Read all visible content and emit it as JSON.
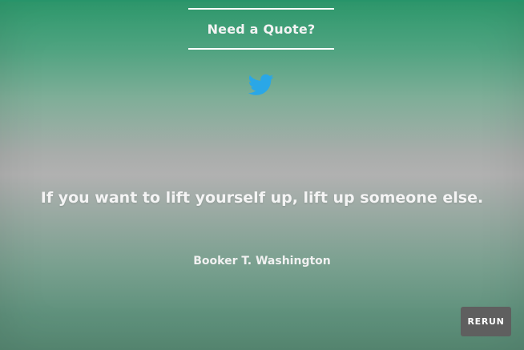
{
  "header": {
    "title": "Need a Quote?"
  },
  "share": {
    "icon": "twitter-icon",
    "color": "#2aa7e7"
  },
  "quote": {
    "text": "If you want to lift yourself up, lift up someone else.",
    "author": "Booker T. Washington"
  },
  "controls": {
    "rerun_label": "RERUN"
  }
}
